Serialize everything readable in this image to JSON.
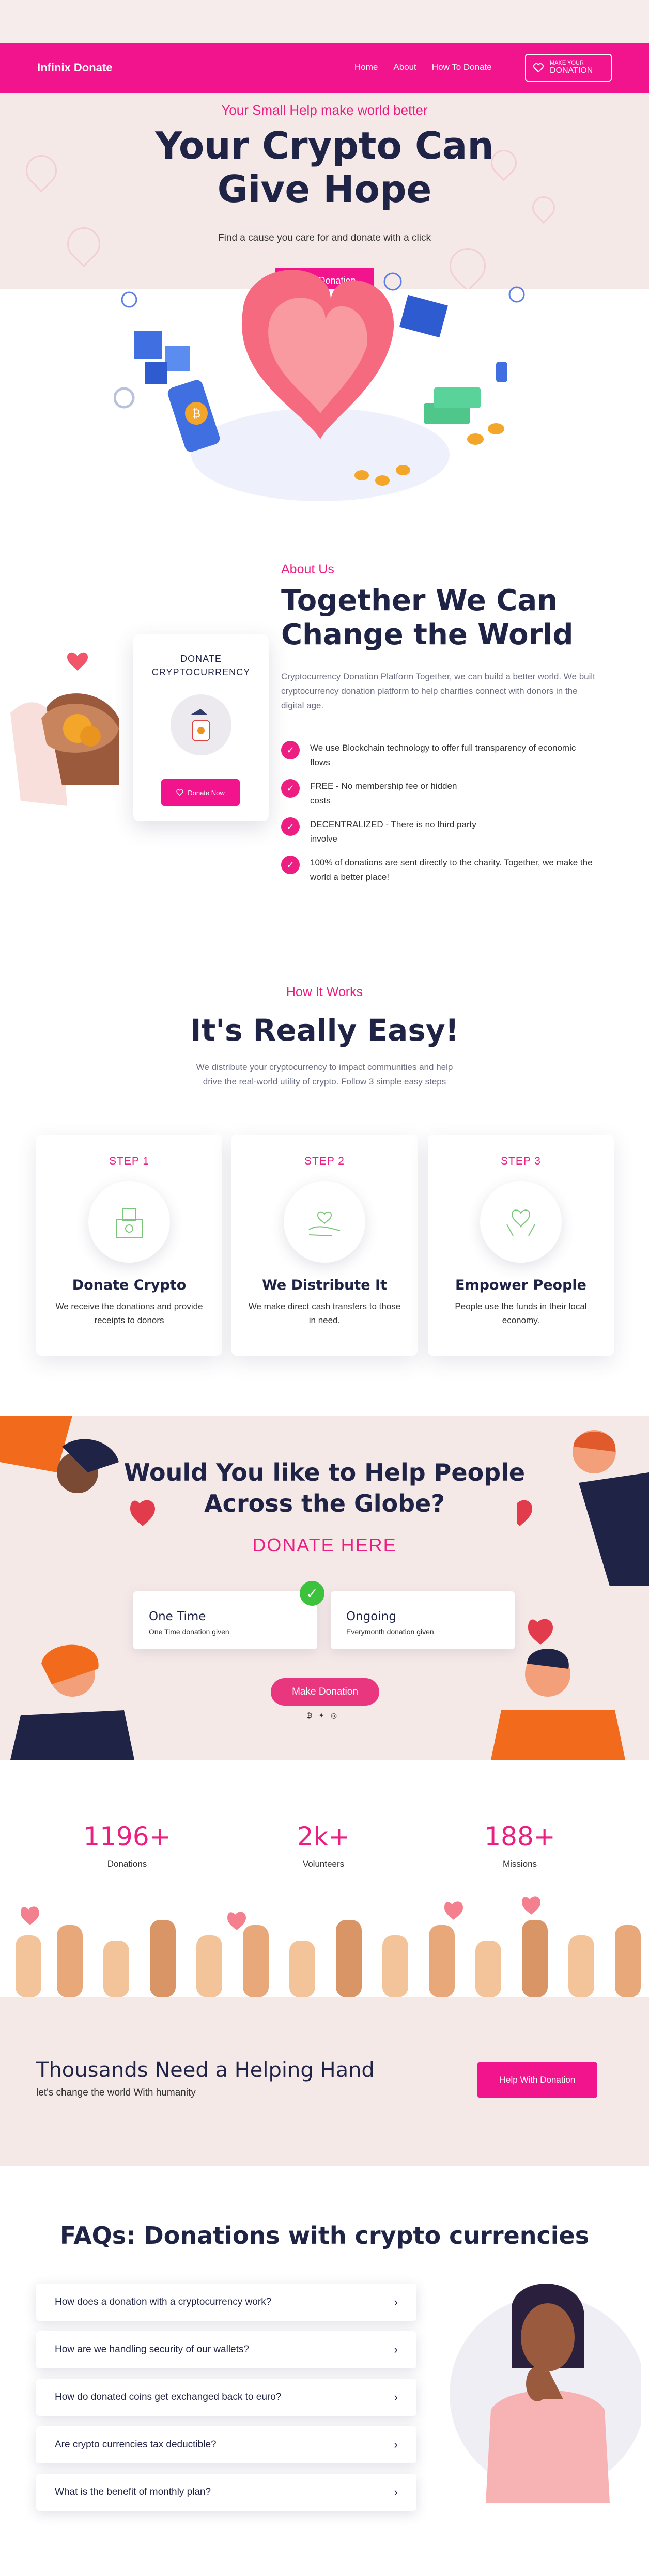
{
  "colors": {
    "accent": "#f1148d",
    "pink_text": "#ec1e82",
    "navy": "#1f2345",
    "blush": "#f5e9e8",
    "success": "#3cc23c"
  },
  "header": {
    "brand": "Infinix Donate",
    "nav": [
      "Home",
      "About",
      "How To Donate"
    ],
    "cta_small": "MAKE YOUR",
    "cta_big": "DONATION",
    "cta_icon": "heart-icon"
  },
  "hero": {
    "tagline": "Your Small Help make world better",
    "title_line1": "Your Crypto Can",
    "title_line2": "Give Hope",
    "subtitle": "Find a cause you care for and donate with a click",
    "button": "Make Donation"
  },
  "about": {
    "label": "About Us",
    "title_line1": "Together We Can",
    "title_line2": "Change the World",
    "paragraph": "Cryptocurrency Donation Platform Together, we can build a better world. We built cryptocurrency donation platform to help charities connect with donors in the digital age.",
    "features": [
      "We use Blockchain technology to offer full transparency of economic flows",
      "FREE - No membership fee or hidden costs",
      "DECENTRALIZED - There is no third party involve",
      "100% of donations are sent directly to the charity. Together, we make the world a better place!"
    ],
    "card": {
      "title_line1": "DONATE",
      "title_line2": "CRYPTOCURRENCY",
      "button": "Donate Now"
    }
  },
  "how": {
    "label": "How It Works",
    "title": "It's Really Easy!",
    "paragraph": "We distribute your cryptocurrency to impact communities and help drive the real-world utility of crypto. Follow 3 simple easy steps",
    "steps": [
      {
        "label": "STEP 1",
        "title": "Donate Crypto",
        "desc": "We receive the donations and provide receipts to donors",
        "icon": "donation-box-icon"
      },
      {
        "label": "STEP 2",
        "title": "We Distribute It",
        "desc": "We make direct cash transfers to those in need.",
        "icon": "hand-heart-icon"
      },
      {
        "label": "STEP 3",
        "title": "Empower People",
        "desc": "People use the funds in their local economy.",
        "icon": "hands-heart-icon"
      }
    ]
  },
  "help": {
    "title_line1": "Would You like to Help People",
    "title_line2": "Across the Globe?",
    "donate_here": "DONATE HERE",
    "options": [
      {
        "title": "One Time",
        "sub": "One Time donation given"
      },
      {
        "title": "Ongoing",
        "sub": "Everymonth donation given"
      }
    ],
    "button": "Make Donation",
    "pay_icons": "₿ ✦ ◎"
  },
  "stats": [
    {
      "number": "1196+",
      "label": "Donations"
    },
    {
      "number": "2k+",
      "label": "Volunteers"
    },
    {
      "number": "188+",
      "label": "Missions"
    }
  ],
  "banner": {
    "title": "Thousands Need a Helping Hand",
    "subtitle": "let's change the world With humanity",
    "button": "Help With Donation"
  },
  "faq": {
    "title": "FAQs: Donations with crypto currencies",
    "items": [
      "How does a donation with a cryptocurrency work?",
      "How are we handling security of our wallets?",
      "How do donated coins get exchanged back to euro?",
      "Are crypto currencies tax deductible?",
      "What is the benefit of monthly plan?"
    ]
  }
}
